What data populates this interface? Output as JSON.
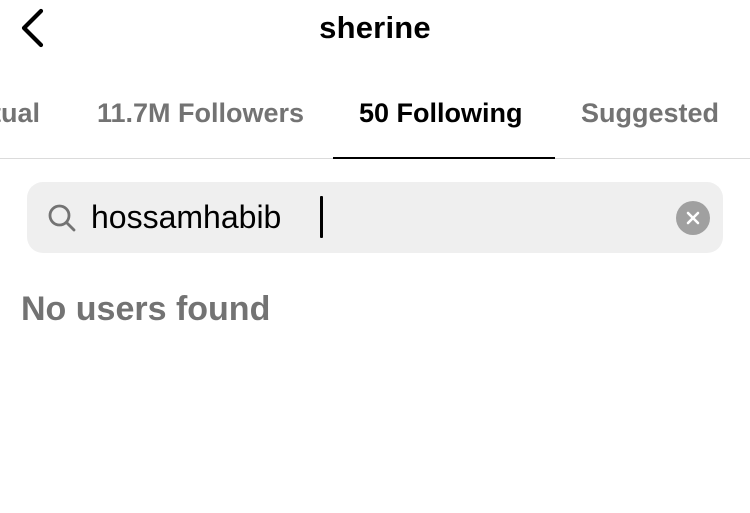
{
  "header": {
    "title": "sherine"
  },
  "tabs": [
    {
      "label": "tual"
    },
    {
      "label": "11.7M Followers"
    },
    {
      "label": "50 Following"
    },
    {
      "label": "Suggested"
    }
  ],
  "active_tab": "50 Following",
  "search": {
    "value": "hossamhabib"
  },
  "results": {
    "empty_message": "No users found"
  },
  "icons": {
    "back": "chevron-left-icon",
    "search": "search-icon",
    "clear": "clear-circle-icon"
  },
  "colors": {
    "active_text": "#000000",
    "inactive_text": "#737373",
    "search_bg": "#efefef",
    "divider": "#dbdbdb"
  }
}
